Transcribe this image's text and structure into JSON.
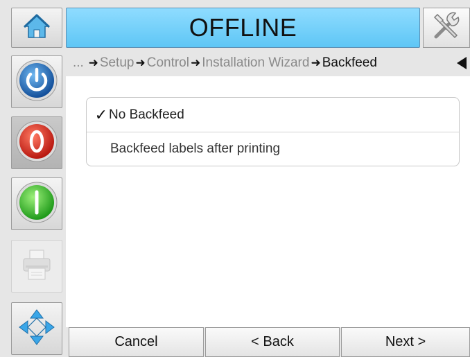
{
  "header": {
    "status_title": "OFFLINE",
    "home_icon": "home-icon",
    "tools_icon": "tools-icon"
  },
  "sidebar": {
    "power_icon": "power-icon",
    "stop_icon": "stop-icon",
    "start_icon": "start-icon",
    "printer_icon": "printer-icon",
    "navigate_icon": "navigate-icon"
  },
  "breadcrumb": {
    "ellipsis": "...",
    "items": [
      "Setup",
      "Control",
      "Installation Wizard",
      "Backfeed"
    ],
    "back_icon": "collapse-left-icon"
  },
  "options": {
    "selected_mark": "✓",
    "items": [
      {
        "label": "No Backfeed",
        "selected": true
      },
      {
        "label": "Backfeed labels after printing",
        "selected": false
      }
    ]
  },
  "footer": {
    "cancel": "Cancel",
    "back": "< Back",
    "next": "Next >"
  },
  "colors": {
    "title_bar": "#6ccdf8",
    "power_blue": "#1f6fc0",
    "stop_red": "#e0261c",
    "start_green": "#3cc62e"
  }
}
